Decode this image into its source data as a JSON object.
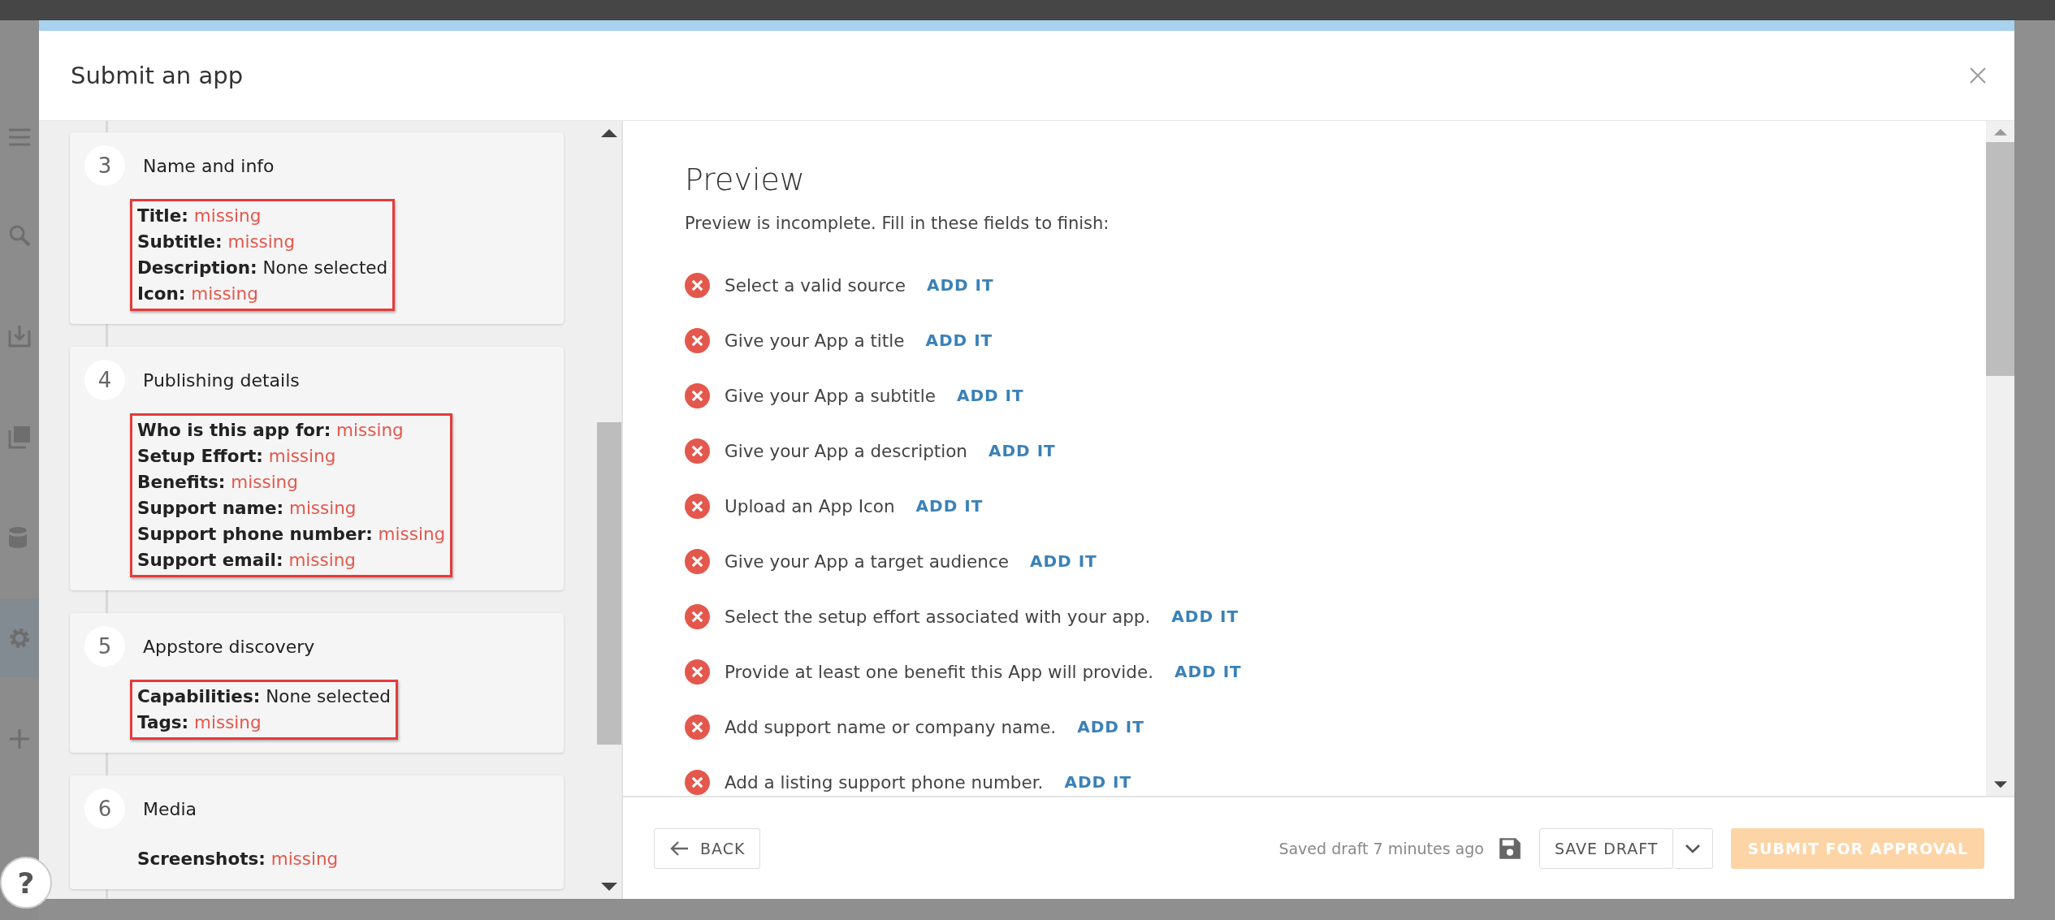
{
  "dialog": {
    "title": "Submit an app"
  },
  "steps": [
    {
      "number": "3",
      "title": "Name and info",
      "highlighted": true,
      "fields": [
        {
          "label": "Title:",
          "value": "missing",
          "color": "#e4574c"
        },
        {
          "label": "Subtitle:",
          "value": "missing",
          "color": "#e4574c"
        },
        {
          "label": "Description:",
          "value": "None selected",
          "color": "#222222"
        },
        {
          "label": "Icon:",
          "value": "missing",
          "color": "#e4574c"
        }
      ]
    },
    {
      "number": "4",
      "title": "Publishing details",
      "highlighted": true,
      "fields": [
        {
          "label": "Who is this app for:",
          "value": "missing",
          "color": "#e4574c"
        },
        {
          "label": "Setup Effort:",
          "value": "missing",
          "color": "#e4574c"
        },
        {
          "label": "Benefits:",
          "value": "missing",
          "color": "#e4574c"
        },
        {
          "label": "Support name:",
          "value": "missing",
          "color": "#e4574c"
        },
        {
          "label": "Support phone number:",
          "value": "missing",
          "color": "#e4574c"
        },
        {
          "label": "Support email:",
          "value": "missing",
          "color": "#e4574c"
        }
      ]
    },
    {
      "number": "5",
      "title": "Appstore discovery",
      "highlighted": true,
      "fields": [
        {
          "label": "Capabilities:",
          "value": "None selected",
          "color": "#222222"
        },
        {
          "label": "Tags:",
          "value": "missing",
          "color": "#e4574c"
        }
      ]
    },
    {
      "number": "6",
      "title": "Media",
      "highlighted": false,
      "fields": [
        {
          "label": "Screenshots:",
          "value": "missing",
          "color": "#e4574c"
        }
      ]
    }
  ],
  "preview": {
    "title": "Preview",
    "intro": "Preview is incomplete. Fill in these fields to finish:",
    "issues": [
      {
        "text": "Select a valid source",
        "action": "ADD IT"
      },
      {
        "text": "Give your App a title",
        "action": "ADD IT"
      },
      {
        "text": "Give your App a subtitle",
        "action": "ADD IT"
      },
      {
        "text": "Give your App a description",
        "action": "ADD IT"
      },
      {
        "text": "Upload an App Icon",
        "action": "ADD IT"
      },
      {
        "text": "Give your App a target audience",
        "action": "ADD IT"
      },
      {
        "text": "Select the setup effort associated with your app.",
        "action": "ADD IT"
      },
      {
        "text": "Provide at least one benefit this App will provide.",
        "action": "ADD IT"
      },
      {
        "text": "Add support name or company name.",
        "action": "ADD IT"
      },
      {
        "text": "Add a listing support phone number.",
        "action": "ADD IT"
      }
    ]
  },
  "footer": {
    "back": "BACK",
    "saved_note": "Saved draft 7 minutes ago",
    "save_draft": "SAVE DRAFT",
    "submit": {
      "label": "SUBMIT FOR APPROVAL",
      "disabled": true
    }
  },
  "help": "?"
}
